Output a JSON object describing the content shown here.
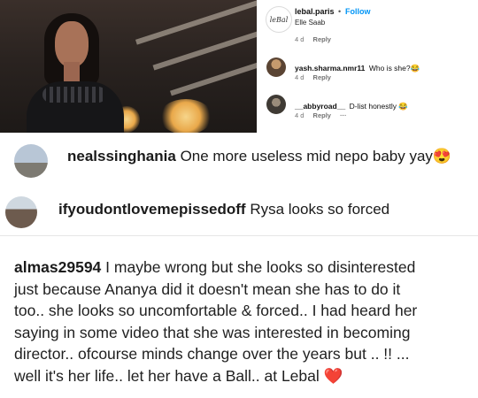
{
  "post": {
    "username": "lebal.paris",
    "separator": "•",
    "follow_label": "Follow",
    "subtitle": "Elle Saab",
    "avatar_text": "leBal",
    "top_meta": {
      "time": "4 d",
      "reply": "Reply"
    }
  },
  "comments": [
    {
      "user": "yash.sharma.nmr11",
      "text": "Who is she?😂",
      "time": "4 d",
      "reply": "Reply"
    },
    {
      "user": "__abbyroad__",
      "text": "D-list honestly 😂",
      "time": "4 d",
      "reply": "Reply",
      "more": "···"
    }
  ],
  "big_comments": [
    {
      "user": "nealssinghania",
      "text": "One more useless mid nepo baby yay😍"
    },
    {
      "user": "ifyoudontlovemepissedoff",
      "text": "Rysa looks so forced"
    }
  ],
  "long_comment": {
    "user": "almas29594",
    "lines": [
      "I maybe wrong but she looks so disinterested",
      "just because Ananya did it doesn't mean she has to do it",
      "too.. she looks so uncomfortable & forced.. I had heard her",
      "saying in some video that she was interested in becoming",
      "director.. ofcourse minds change over the years but .. !! ...",
      "well it's her life.. let her have a Ball.. at Lebal ❤️"
    ]
  },
  "colors": {
    "link_blue": "#0095f6",
    "meta_gray": "#737373"
  }
}
